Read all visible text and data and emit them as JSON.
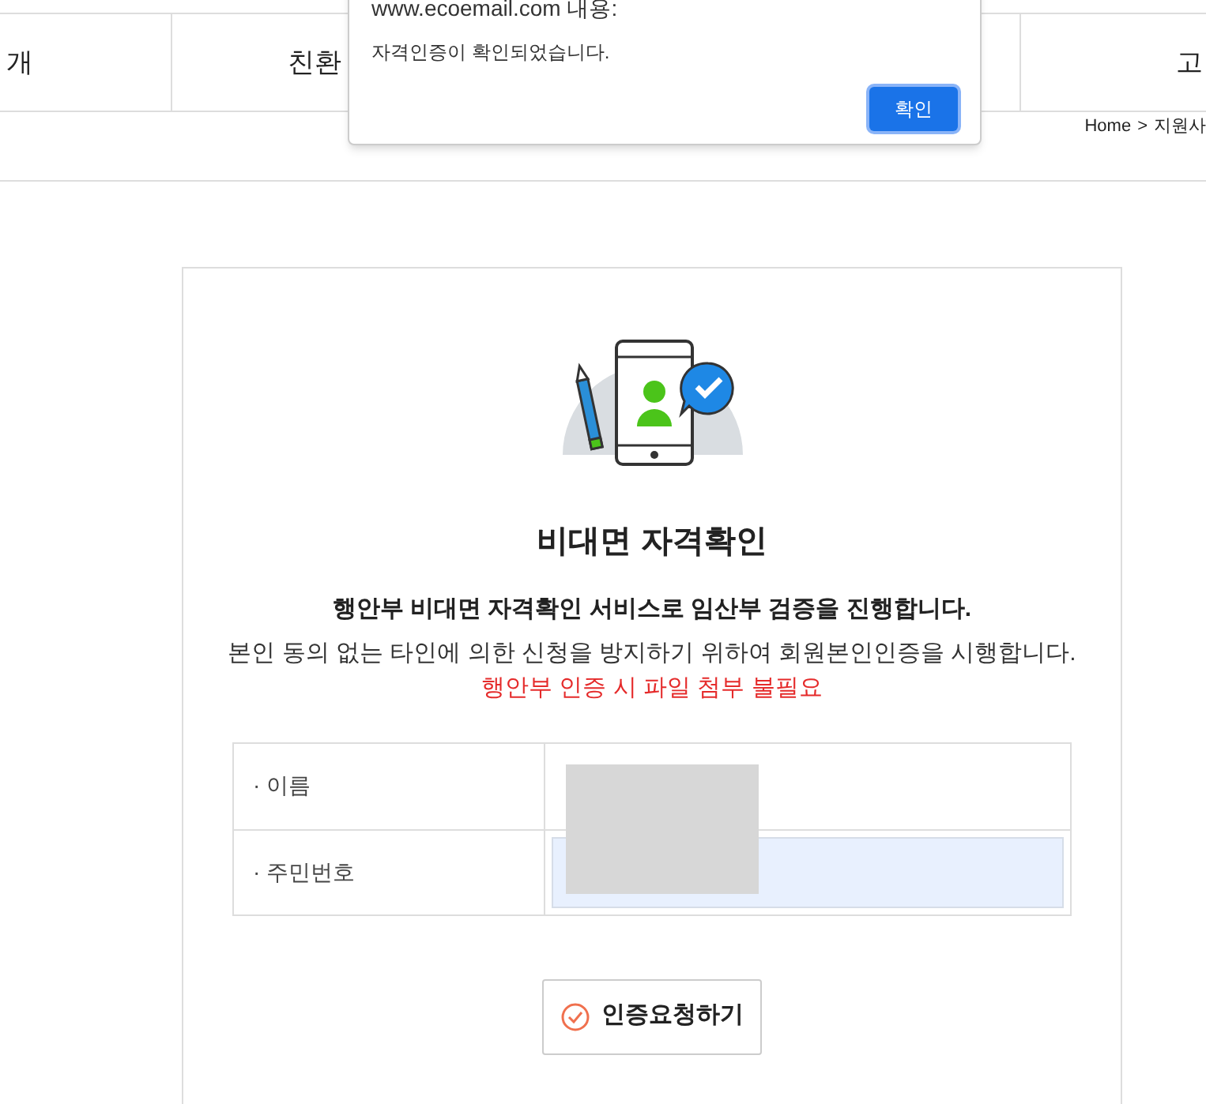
{
  "nav": {
    "items": [
      "개",
      "친환",
      "고"
    ]
  },
  "breadcrumb": {
    "home": "Home",
    "separator": ">",
    "current": "지원사"
  },
  "dialog": {
    "title": "www.ecoemail.com 내용:",
    "message": "자격인증이 확인되었습니다.",
    "button": "확인"
  },
  "card": {
    "title": "비대면 자격확인",
    "lead": "행안부 비대면 자격확인 서비스로 임산부 검증을 진행합니다.",
    "description": "본인 동의 없는 타인에 의한 신청을 방지하기 위하여 회원본인인증을 시행합니다.",
    "notice": "행안부 인증 시 파일 첨부 불필요"
  },
  "form": {
    "rows": [
      {
        "label": "· 이름",
        "autofilled": false
      },
      {
        "label": "· 주민번호",
        "autofilled": true
      }
    ]
  },
  "submit": {
    "label": "인증요청하기"
  }
}
